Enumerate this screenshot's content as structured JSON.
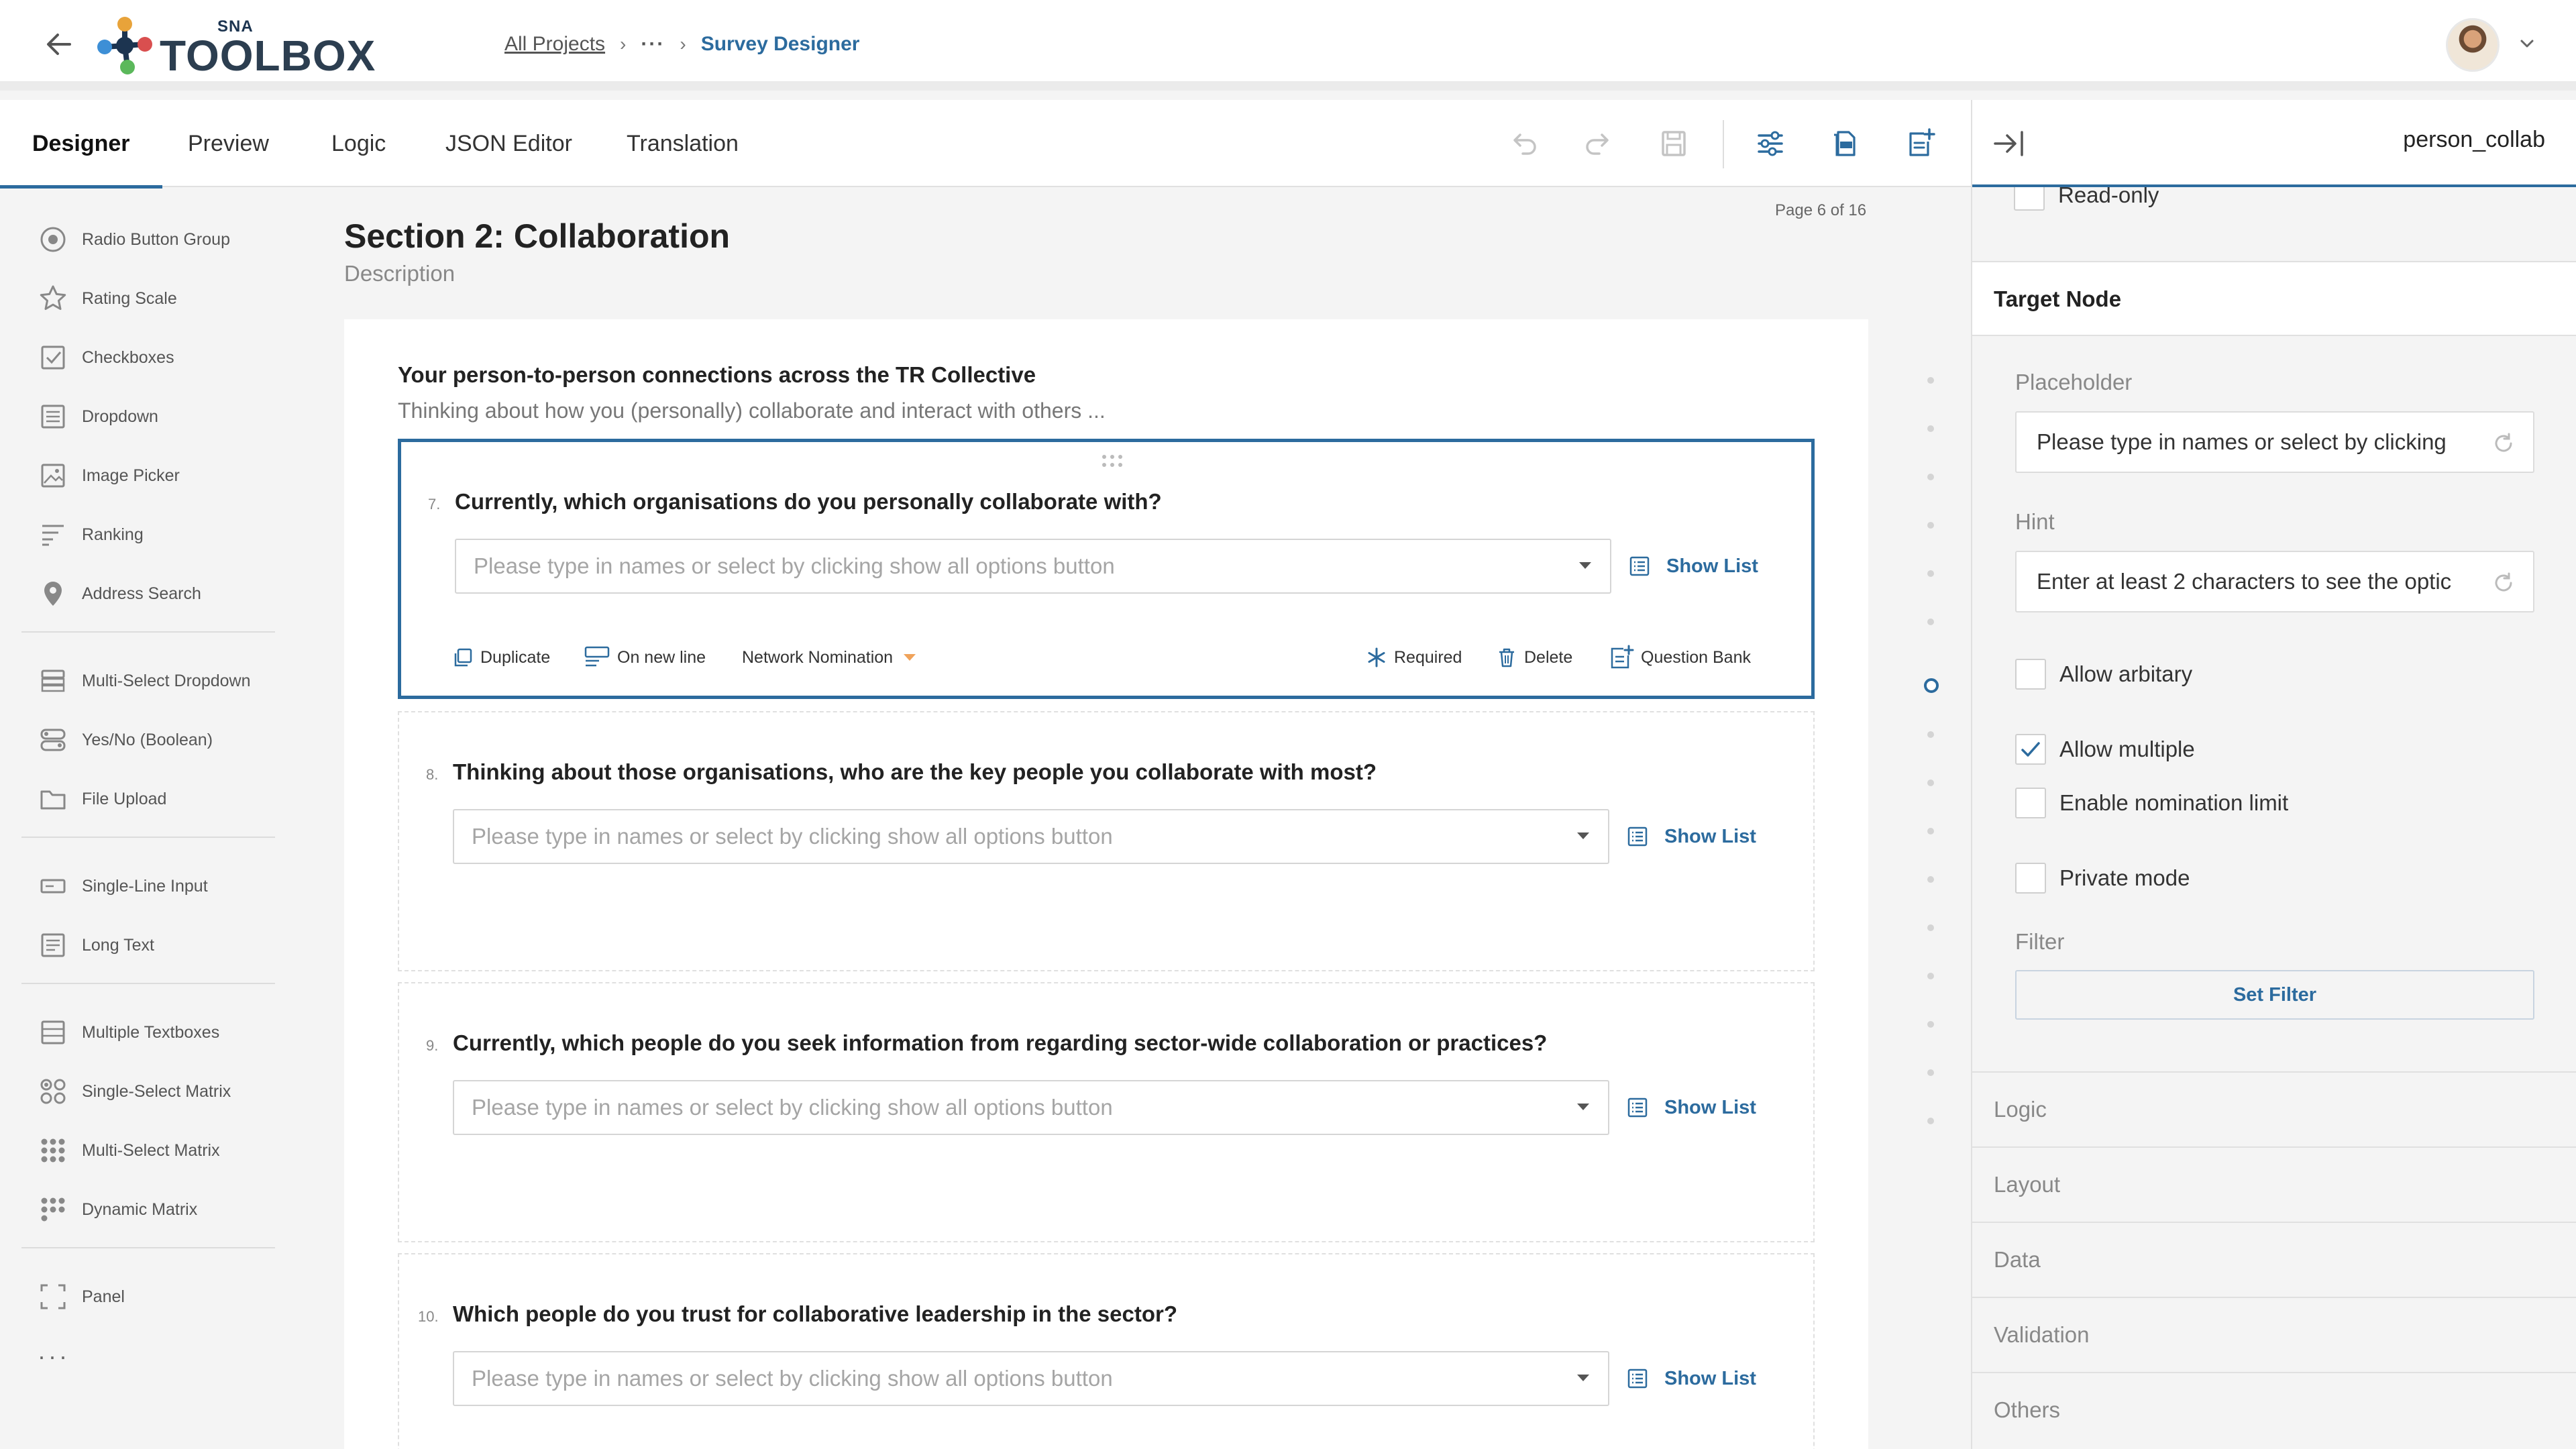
{
  "header": {
    "logo_sup": "SNA",
    "logo_text": "TOOLBOX",
    "breadcrumb": {
      "root": "All Projects",
      "ellipsis": "···",
      "current": "Survey Designer"
    }
  },
  "tabs": [
    {
      "label": "Designer"
    },
    {
      "label": "Preview"
    },
    {
      "label": "Logic"
    },
    {
      "label": "JSON Editor"
    },
    {
      "label": "Translation"
    }
  ],
  "sidebar": {
    "items": [
      {
        "label": "Radio Button Group",
        "icon": "radio-icon"
      },
      {
        "label": "Rating Scale",
        "icon": "star-icon"
      },
      {
        "label": "Checkboxes",
        "icon": "checkbox-icon"
      },
      {
        "label": "Dropdown",
        "icon": "dropdown-icon"
      },
      {
        "label": "Image Picker",
        "icon": "image-icon"
      },
      {
        "label": "Ranking",
        "icon": "ranking-icon"
      },
      {
        "label": "Address Search",
        "icon": "location-pin-icon"
      },
      {
        "label": "Multi-Select Dropdown",
        "icon": "multi-dropdown-icon"
      },
      {
        "label": "Yes/No (Boolean)",
        "icon": "toggle-icon"
      },
      {
        "label": "File Upload",
        "icon": "folder-icon"
      },
      {
        "label": "Single-Line Input",
        "icon": "input-icon"
      },
      {
        "label": "Long Text",
        "icon": "text-lines-icon"
      },
      {
        "label": "Multiple Textboxes",
        "icon": "textboxes-icon"
      },
      {
        "label": "Single-Select Matrix",
        "icon": "matrix-icon"
      },
      {
        "label": "Multi-Select Matrix",
        "icon": "grid-icon"
      },
      {
        "label": "Dynamic Matrix",
        "icon": "dynamic-grid-icon"
      },
      {
        "label": "Panel",
        "icon": "panel-icon"
      }
    ],
    "more": "···"
  },
  "canvas": {
    "page_indicator": "Page 6 of 16",
    "section_title": "Section 2: Collaboration",
    "section_description": "Description",
    "panel_title": "Your person-to-person connections across the TR Collective",
    "panel_description": "Thinking about how you (personally) collaborate and interact with others ...",
    "questions": [
      {
        "number": "7.",
        "text": "Currently, which organisations do you personally collaborate with?",
        "placeholder": "Please type in names or select by clicking show all options button",
        "show_list": "Show List"
      },
      {
        "number": "8.",
        "text": "Thinking about those organisations, who are the key people you collaborate with most?",
        "placeholder": "Please type in names or select by clicking show all options button",
        "show_list": "Show List"
      },
      {
        "number": "9.",
        "text": "Currently, which people do you seek information from regarding sector-wide collaboration or practices?",
        "placeholder": "Please type in names or select by clicking show all options button",
        "show_list": "Show List"
      },
      {
        "number": "10.",
        "text": "Which people do you trust for collaborative leadership in the sector?",
        "placeholder": "Please type in names or select by clicking show all options button",
        "show_list": "Show List"
      }
    ],
    "actions": {
      "duplicate": "Duplicate",
      "new_line": "On new line",
      "question_type": "Network Nomination",
      "required": "Required",
      "delete": "Delete",
      "question_bank": "Question Bank"
    }
  },
  "properties": {
    "name": "person_collab",
    "readonly_label": "Read-only",
    "section": "Target Node",
    "placeholder_label": "Placeholder",
    "placeholder_value": "Please type in names or select by clicking",
    "hint_label": "Hint",
    "hint_value": "Enter at least 2 characters to see the optic",
    "allow_arbitrary": {
      "label": "Allow arbitary",
      "checked": false
    },
    "allow_multiple": {
      "label": "Allow multiple",
      "checked": true
    },
    "nomination_limit": {
      "label": "Enable nomination limit",
      "checked": false
    },
    "private_mode": {
      "label": "Private mode",
      "checked": false
    },
    "filter_label": "Filter",
    "set_filter": "Set Filter",
    "accordions": [
      "Logic",
      "Layout",
      "Data",
      "Validation",
      "Others"
    ]
  },
  "colors": {
    "accent": "#2c6b9e",
    "logo": "#2c3e50",
    "background": "#f4f4f4"
  }
}
